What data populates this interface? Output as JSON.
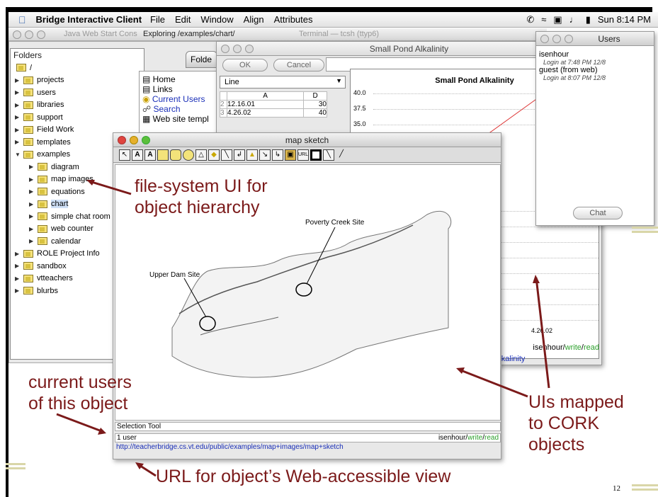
{
  "menubar": {
    "app": "Bridge Interactive Client",
    "items": [
      "File",
      "Edit",
      "Window",
      "Align",
      "Attributes"
    ],
    "clock": "Sun 8:14 PM"
  },
  "bg_windows": {
    "java": "Java Web Start Cons",
    "exploring": "Exploring /examples/chart/",
    "terminal": "Terminal — tcsh (ttyp6)"
  },
  "folders": {
    "header": "Folders",
    "tab": "Folde",
    "root": "/",
    "items": [
      {
        "label": "projects",
        "indent": 1,
        "open": false
      },
      {
        "label": "users",
        "indent": 1,
        "open": false
      },
      {
        "label": "libraries",
        "indent": 1,
        "open": false
      },
      {
        "label": "support",
        "indent": 1,
        "open": false
      },
      {
        "label": "Field Work",
        "indent": 1,
        "open": false
      },
      {
        "label": "templates",
        "indent": 1,
        "open": false
      },
      {
        "label": "examples",
        "indent": 1,
        "open": true
      },
      {
        "label": "diagram",
        "indent": 2,
        "open": false
      },
      {
        "label": "map images",
        "indent": 2,
        "open": false
      },
      {
        "label": "equations",
        "indent": 2,
        "open": false
      },
      {
        "label": "chart",
        "indent": 2,
        "open": false
      },
      {
        "label": "simple chat room",
        "indent": 2,
        "open": false
      },
      {
        "label": "web counter",
        "indent": 2,
        "open": false
      },
      {
        "label": "calendar",
        "indent": 2,
        "open": false
      },
      {
        "label": "ROLE Project Info",
        "indent": 1,
        "open": false
      },
      {
        "label": "sandbox",
        "indent": 1,
        "open": false
      },
      {
        "label": "vtteachers",
        "indent": 1,
        "open": false
      },
      {
        "label": "blurbs",
        "indent": 1,
        "open": false
      }
    ]
  },
  "contents": {
    "items": [
      "Home",
      "Links",
      "Current Users",
      "Search",
      "Web site templ"
    ]
  },
  "chart": {
    "window_title": "Small Pond Alkalinity",
    "ok": "OK",
    "cancel": "Cancel",
    "chart_type": "Line",
    "title": "Small Pond Alkalinity",
    "table_headers": [
      "A",
      "D"
    ],
    "rows": [
      {
        "n": "2",
        "a": "12.16.01",
        "d": "30"
      },
      {
        "n": "3",
        "a": "4.26.02",
        "d": "40"
      }
    ],
    "yticks": [
      "40.0",
      "37.5",
      "35.0"
    ],
    "xlabel": "4.26.02",
    "status_user": "isenhour",
    "write": "write",
    "read": "read",
    "footer": "Alkalinity"
  },
  "users": {
    "title": "Users",
    "list": [
      {
        "name": "isenhour",
        "login": "Login at 7:48 PM 12/8"
      },
      {
        "name": "guest (from web)",
        "login": "Login at 8:07 PM 12/8"
      }
    ],
    "chat": "Chat"
  },
  "map": {
    "title": "map sketch",
    "sites": {
      "poverty": "Poverty Creek Site",
      "upper": "Upper Dam Site"
    },
    "tool_status": "Selection Tool",
    "user_count": "1 user",
    "user": "isenhour",
    "write": "write",
    "read": "read",
    "url": "http://teacherbridge.cs.vt.edu/public/examples/map+images/map+sketch"
  },
  "annotations": {
    "fs1": "file-system UI for",
    "fs2": "object hierarchy",
    "cu1": "current users",
    "cu2": "of this object",
    "ui1": "UIs mapped",
    "ui2": "to CORK",
    "ui3": "objects",
    "url": "URL for object’s Web-accessible view"
  },
  "page_number": "12",
  "colors": {
    "annotation": "#7b1a1a",
    "link": "#1a2fb8",
    "write": "#2ca02c",
    "read": "#2ca02c"
  }
}
